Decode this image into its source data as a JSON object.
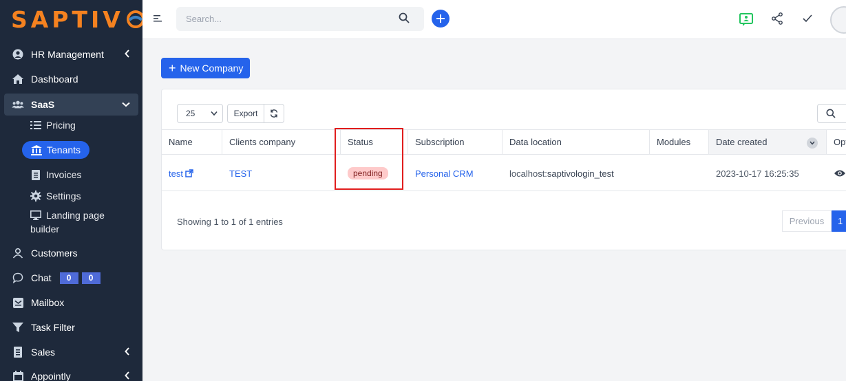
{
  "brand": {
    "logo_text": "SAPTIV"
  },
  "sidebar": {
    "items": [
      {
        "label": "HR Management"
      },
      {
        "label": "Dashboard"
      },
      {
        "label": "SaaS"
      },
      {
        "label": "Customers"
      },
      {
        "label": "Chat",
        "badge1": "0",
        "badge2": "0"
      },
      {
        "label": "Mailbox"
      },
      {
        "label": "Task Filter"
      },
      {
        "label": "Sales"
      },
      {
        "label": "Appointly"
      }
    ],
    "saas_sub": [
      {
        "label": "Pricing"
      },
      {
        "label": "Tenants"
      },
      {
        "label": "Invoices"
      },
      {
        "label": "Settings"
      },
      {
        "label": "Landing page",
        "label2": "builder"
      }
    ]
  },
  "topbar": {
    "search_placeholder": "Search..."
  },
  "page": {
    "new_button_label": "New Company"
  },
  "table_controls": {
    "page_size": "25",
    "export_label": "Export"
  },
  "table": {
    "headers": [
      "Name",
      "Clients company",
      "Status",
      "Subscription",
      "Data location",
      "Modules",
      "Date created",
      "Opt"
    ],
    "rows": [
      {
        "name": "test",
        "clients_company": "TEST",
        "status": "pending",
        "subscription": "Personal CRM",
        "data_location_prefix": "localhost:",
        "data_location_db": "saptivologin_test",
        "modules": "",
        "date_created": "2023-10-17 16:25:35"
      }
    ]
  },
  "footer": {
    "showing": "Showing 1 to 1 of 1 entries",
    "prev_label": "Previous",
    "page_label": "1"
  },
  "colors": {
    "accent": "#2563eb",
    "sidebar": "#1e293b",
    "logo": "#f58220",
    "pending_bg": "#fecaca",
    "highlight_box": "#e11d1d"
  }
}
